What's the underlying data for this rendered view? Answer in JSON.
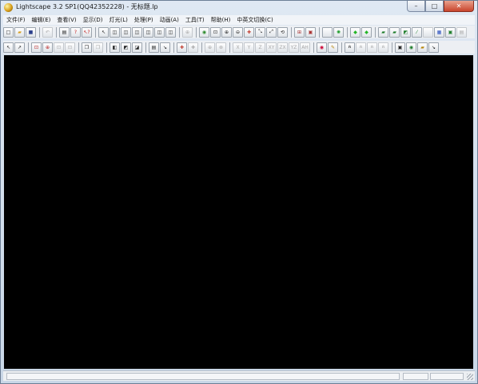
{
  "window": {
    "title": "Lightscape 3.2 SP1(QQ42352228)  - 无标题.lp"
  },
  "menu": [
    "文件(F)",
    "编辑(E)",
    "查看(V)",
    "显示(D)",
    "灯光(L)",
    "处理(P)",
    "动画(A)",
    "工具(T)",
    "帮助(H)",
    "中英文切换(C)"
  ],
  "toolbar1": [
    {
      "name": "new-file-icon",
      "glyph": "□"
    },
    {
      "name": "open-folder-icon",
      "glyph": "▰",
      "color": "#d9a021"
    },
    {
      "name": "save-disk-icon",
      "glyph": "■",
      "color": "#2b3f8c"
    },
    {
      "sep": true
    },
    {
      "name": "undo-icon",
      "glyph": "↶",
      "dis": true
    },
    {
      "sep": true
    },
    {
      "name": "print-icon",
      "glyph": "▤"
    },
    {
      "name": "help-icon",
      "glyph": "?",
      "color": "#c01818"
    },
    {
      "name": "context-help-icon",
      "glyph": "↖?",
      "color": "#c01818"
    },
    {
      "sep": true
    },
    {
      "name": "select-arrow-icon",
      "glyph": "↖"
    },
    {
      "name": "cube-view-1-icon",
      "glyph": "◫"
    },
    {
      "name": "cube-view-2-icon",
      "glyph": "◫"
    },
    {
      "name": "cube-view-3-icon",
      "glyph": "◫"
    },
    {
      "name": "cube-view-4-icon",
      "glyph": "◫"
    },
    {
      "name": "cube-view-5-icon",
      "glyph": "◫"
    },
    {
      "name": "cube-view-6-icon",
      "glyph": "◫"
    },
    {
      "sep": true
    },
    {
      "name": "zoom-extents-icon",
      "glyph": "⊕",
      "dis": true
    },
    {
      "sep": true
    },
    {
      "name": "eye-icon",
      "glyph": "◉",
      "color": "#2a8a2a"
    },
    {
      "name": "zoom-window-icon",
      "glyph": "⊡"
    },
    {
      "name": "zoom-in-icon",
      "glyph": "⊕"
    },
    {
      "name": "zoom-icon",
      "glyph": "⊖"
    },
    {
      "name": "pan-cross-icon",
      "glyph": "✚",
      "color": "#c0392b"
    },
    {
      "name": "orbit-icon",
      "glyph": "⤡"
    },
    {
      "name": "walk-icon",
      "glyph": "⤢"
    },
    {
      "name": "rotate-icon",
      "glyph": "⟲"
    },
    {
      "sep": true
    },
    {
      "name": "zoom-select-icon",
      "glyph": "⊞",
      "color": "#a33"
    },
    {
      "name": "camera-icon",
      "glyph": "▣",
      "color": "#a33"
    },
    {
      "sep": true
    },
    {
      "name": "blank-icon",
      "glyph": ""
    },
    {
      "name": "gear-green-icon",
      "glyph": "✺",
      "color": "#1e9c2b"
    },
    {
      "sep": true
    },
    {
      "name": "green-cube-icon",
      "glyph": "◆",
      "color": "#22b525"
    },
    {
      "name": "green-cube-2-icon",
      "glyph": "◆",
      "color": "#22b525"
    },
    {
      "sep": true
    },
    {
      "name": "render-1-icon",
      "glyph": "▰",
      "color": "#1e7d2b"
    },
    {
      "name": "render-2-icon",
      "glyph": "▰",
      "color": "#1e7d2b"
    },
    {
      "name": "render-3-icon",
      "glyph": "◩",
      "color": "#1e7d2b"
    },
    {
      "name": "render-4-icon",
      "glyph": "⁄",
      "color": "#1e7d2b"
    },
    {
      "name": "blank-2-icon",
      "glyph": "",
      "dis": true
    },
    {
      "name": "window-icon",
      "glyph": "▦",
      "color": "#2a4fbf"
    },
    {
      "name": "green-frame-icon",
      "glyph": "▣",
      "color": "#1e7d2b"
    },
    {
      "name": "gray-window-icon",
      "glyph": "▤",
      "dis": true
    }
  ],
  "toolbar2": [
    {
      "name": "pointer-icon",
      "glyph": "↖"
    },
    {
      "name": "pointer-plus-icon",
      "glyph": "↗"
    },
    {
      "sep": true
    },
    {
      "name": "select-window-icon",
      "glyph": "⊡",
      "color": "#b22"
    },
    {
      "name": "select-zoom-icon",
      "glyph": "⊕",
      "color": "#b22"
    },
    {
      "name": "select-disabled-1-icon",
      "glyph": "⊡",
      "dis": true
    },
    {
      "name": "select-disabled-2-icon",
      "glyph": "⊡",
      "dis": true
    },
    {
      "sep": true
    },
    {
      "name": "copy-icon",
      "glyph": "❐"
    },
    {
      "name": "paste-icon",
      "glyph": "❐",
      "dis": true
    },
    {
      "sep": true
    },
    {
      "name": "material-1-icon",
      "glyph": "◧"
    },
    {
      "name": "material-2-icon",
      "glyph": "◩"
    },
    {
      "name": "material-3-icon",
      "glyph": "◪"
    },
    {
      "sep": true
    },
    {
      "name": "layer-icon",
      "glyph": "▤"
    },
    {
      "name": "light-arrow-icon",
      "glyph": "↘"
    },
    {
      "sep": true
    },
    {
      "name": "move-light-icon",
      "glyph": "✚",
      "color": "#c0392b"
    },
    {
      "name": "move-light-disabled-icon",
      "glyph": "✚",
      "dis": true
    },
    {
      "sep": true
    },
    {
      "name": "axis-disabled-1-icon",
      "glyph": "⊕",
      "dis": true
    },
    {
      "name": "axis-disabled-2-icon",
      "glyph": "⊗",
      "dis": true
    },
    {
      "sep": true
    },
    {
      "name": "axis-x-icon",
      "glyph": "X",
      "dis": true
    },
    {
      "name": "axis-y-icon",
      "glyph": "Y",
      "dis": true
    },
    {
      "name": "axis-z-icon",
      "glyph": "Z",
      "dis": true
    },
    {
      "name": "axis-xy-icon",
      "glyph": "XY",
      "dis": true
    },
    {
      "name": "axis-zx-icon",
      "glyph": "ZX",
      "dis": true
    },
    {
      "name": "axis-yz-icon",
      "glyph": "YZ",
      "dis": true
    },
    {
      "name": "axis-all-icon",
      "glyph": "AH",
      "dis": true
    },
    {
      "sep": true
    },
    {
      "name": "paint-icon",
      "glyph": "◉",
      "color": "#c03"
    },
    {
      "name": "brush-icon",
      "glyph": "✎",
      "color": "#b8860b"
    },
    {
      "sep": true
    },
    {
      "name": "person-icon",
      "glyph": "ጰ"
    },
    {
      "name": "person-2-icon",
      "glyph": "ጰ",
      "dis": true
    },
    {
      "name": "person-3-icon",
      "glyph": "ጰ",
      "dis": true
    },
    {
      "name": "person-4-icon",
      "glyph": "ጰ",
      "dis": true
    },
    {
      "sep": true
    },
    {
      "name": "tool-1-icon",
      "glyph": "▣"
    },
    {
      "name": "tool-2-icon",
      "glyph": "◉",
      "color": "#1e7d2b"
    },
    {
      "name": "tool-3-icon",
      "glyph": "▰",
      "color": "#b8860b"
    },
    {
      "name": "tool-4-icon",
      "glyph": "↘"
    }
  ],
  "winbuttons": {
    "min": "–",
    "max": "□",
    "close": "✕"
  }
}
